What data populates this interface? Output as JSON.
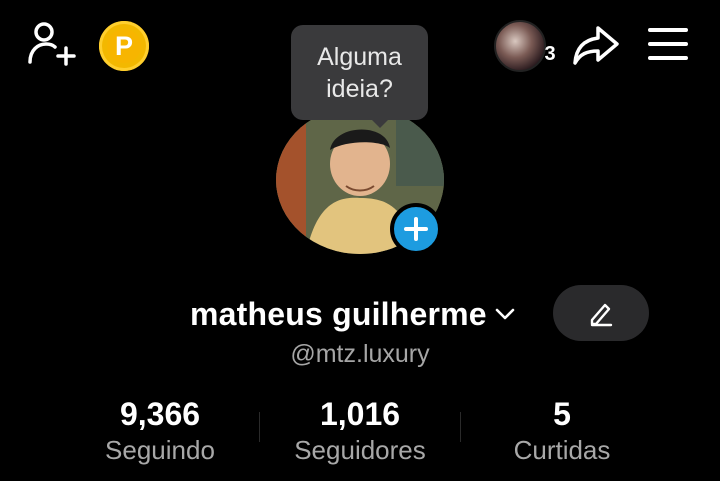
{
  "header": {
    "add_friend_icon": "person-add-icon",
    "coin_icon": "coin-p-icon",
    "coin_letter": "P",
    "friends_badge_count": "3",
    "share_icon": "share-arrow-icon",
    "menu_icon": "hamburger-menu-icon"
  },
  "tooltip": {
    "line1": "Alguma",
    "line2": "ideia?"
  },
  "profile": {
    "name": "matheus guilherme",
    "handle": "@mtz.luxury",
    "edit_icon": "pencil-icon",
    "add_icon": "plus-icon"
  },
  "stats": [
    {
      "value": "9,366",
      "label": "Seguindo"
    },
    {
      "value": "1,016",
      "label": "Seguidores"
    },
    {
      "value": "5",
      "label": "Curtidas"
    }
  ],
  "colors": {
    "background": "#000000",
    "coin": "#f3b800",
    "plus_button": "#1d9ce0",
    "tooltip_bg": "#3a3a3c",
    "secondary_text": "#a6a6a6"
  }
}
